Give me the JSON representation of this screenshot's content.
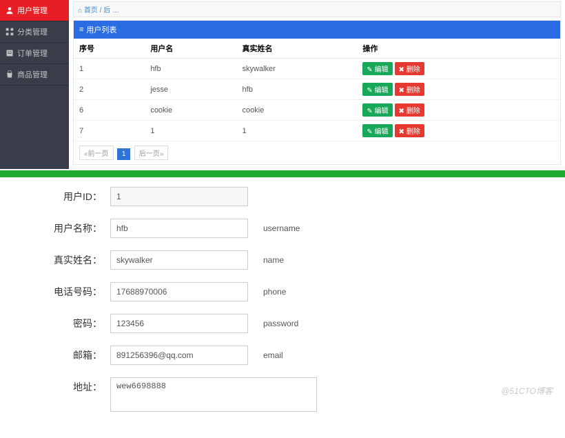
{
  "sidebar": {
    "items": [
      {
        "label": "用户管理",
        "active": true
      },
      {
        "label": "分类管理",
        "active": false
      },
      {
        "label": "订单管理",
        "active": false
      },
      {
        "label": "商品管理",
        "active": false
      }
    ]
  },
  "breadcrumb": {
    "text": "首页 / 后 …"
  },
  "panel": {
    "title": "用户列表",
    "columns": [
      "序号",
      "用户名",
      "真实姓名",
      "操作"
    ],
    "edit_label": "编辑",
    "delete_label": "删除",
    "rows": [
      {
        "id": "1",
        "username": "hfb",
        "realname": "skywalker"
      },
      {
        "id": "2",
        "username": "jesse",
        "realname": "hfb"
      },
      {
        "id": "6",
        "username": "cookie",
        "realname": "cookie"
      },
      {
        "id": "7",
        "username": "1",
        "realname": "1"
      }
    ]
  },
  "pager": {
    "prev": "«前一页",
    "current": "1",
    "next": "后一页»"
  },
  "form": {
    "fields": [
      {
        "label": "用户ID：",
        "value": "1",
        "hint": "",
        "readonly": true,
        "type": "text"
      },
      {
        "label": "用户名称：",
        "value": "hfb",
        "hint": "username",
        "readonly": false,
        "type": "text"
      },
      {
        "label": "真实姓名：",
        "value": "skywalker",
        "hint": "name",
        "readonly": false,
        "type": "text"
      },
      {
        "label": "电话号码：",
        "value": "17688970006",
        "hint": "phone",
        "readonly": false,
        "type": "text"
      },
      {
        "label": "密码：",
        "value": "123456",
        "hint": "password",
        "readonly": false,
        "type": "text"
      },
      {
        "label": "邮箱：",
        "value": "891256396@qq.com",
        "hint": "email",
        "readonly": false,
        "type": "text"
      },
      {
        "label": "地址：",
        "value": "wew6698888",
        "hint": "",
        "readonly": false,
        "type": "textarea"
      }
    ]
  },
  "watermark": "@51CTO博客"
}
